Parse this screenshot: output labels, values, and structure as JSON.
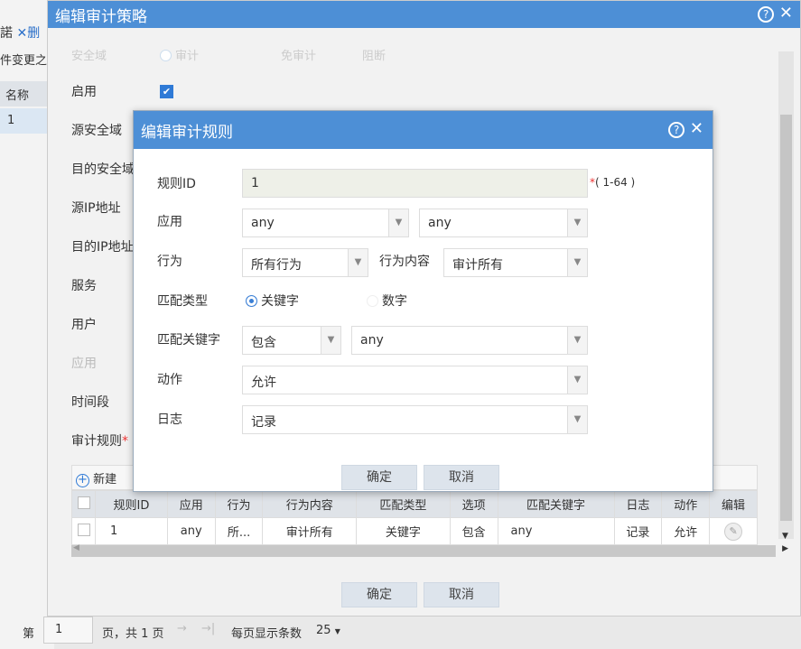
{
  "background": {
    "toolbar_delete": "删",
    "tab_text": "件变更之",
    "col_name": "名称",
    "row_value": "1"
  },
  "outer": {
    "title": "编辑审计策略",
    "help": "?",
    "close": "✕",
    "faded_row": {
      "label": "安全域",
      "opt1": "审计",
      "opt2": "免审计",
      "opt3": "阻断"
    },
    "labels": [
      "启用",
      "源安全域",
      "目的安全域",
      "源IP地址",
      "目的IP地址",
      "服务",
      "用户",
      "应用",
      "时间段",
      "审计规则"
    ],
    "required": "*",
    "new_label": "新建",
    "table": {
      "headers": [
        "规则ID",
        "应用",
        "行为",
        "行为内容",
        "匹配类型",
        "选项",
        "匹配关键字",
        "日志",
        "动作",
        "编辑"
      ],
      "rows": [
        [
          "1",
          "any",
          "所...",
          "审计所有",
          "关键字",
          "包含",
          "any",
          "记录",
          "允许"
        ]
      ]
    },
    "ok": "确定",
    "cancel": "取消"
  },
  "inner": {
    "title": "编辑审计规则",
    "help": "?",
    "close": "✕",
    "rule_id_label": "规则ID",
    "rule_id": "1",
    "rule_id_hint": "( 1-64 )",
    "required": "*",
    "app_label": "应用",
    "app1": "any",
    "app2": "any",
    "behavior_label": "行为",
    "behavior": "所有行为",
    "content_label": "行为内容",
    "content": "审计所有",
    "match_type_label": "匹配类型",
    "match_keyword": "关键字",
    "match_number": "数字",
    "keyword_label": "匹配关键字",
    "keyword_op": "包含",
    "keyword": "any",
    "action_label": "动作",
    "action": "允许",
    "log_label": "日志",
    "log": "记录",
    "ok": "确定",
    "cancel": "取消"
  },
  "pager": {
    "page_prefix": "第",
    "page": "1",
    "page_suffix": "页，共 1 页",
    "next": "→",
    "last": "→|",
    "per_page_label": "每页显示条数",
    "per_page": "25"
  }
}
